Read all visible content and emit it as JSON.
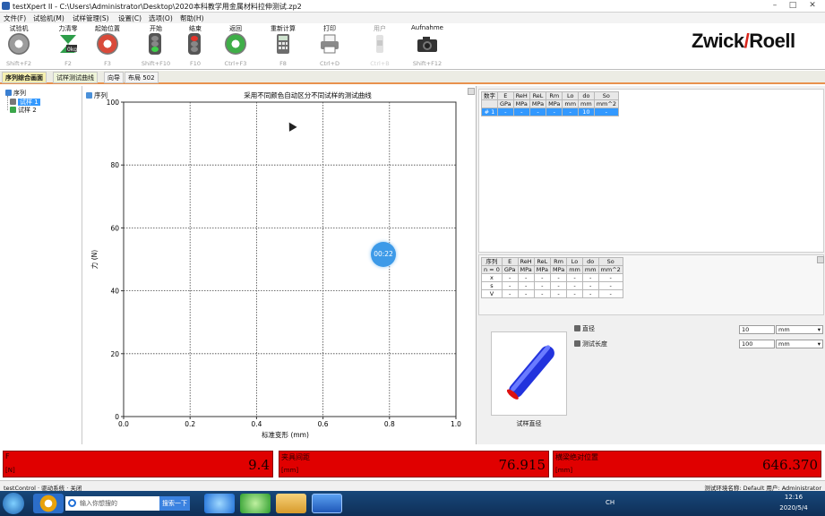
{
  "window": {
    "title": "testXpert II - C:\\Users\\Administrator\\Desktop\\2020本科教学用金属材料拉伸测试.zp2"
  },
  "menu": [
    "文件(F)",
    "试验机(M)",
    "试样管理(S)",
    "设置(C)",
    "选项(O)",
    "帮助(H)"
  ],
  "toolbar": [
    {
      "label": "试验机",
      "shortcut": "Shift+F2",
      "icon": "gear-icon"
    },
    {
      "label": "力清零",
      "shortcut": "F2",
      "icon": "force-zero-icon"
    },
    {
      "label": "起始位置",
      "shortcut": "F3",
      "icon": "gear-icon"
    },
    {
      "label": "开始",
      "shortcut": "Shift+F10",
      "icon": "traffic-light-icon"
    },
    {
      "label": "结束",
      "shortcut": "F10",
      "icon": "traffic-light-icon"
    },
    {
      "label": "返回",
      "shortcut": "Ctrl+F3",
      "icon": "gear-icon"
    },
    {
      "label": "重新计算",
      "shortcut": "F8",
      "icon": "calculator-icon"
    },
    {
      "label": "打印",
      "shortcut": "Ctrl+D",
      "icon": "printer-icon"
    },
    {
      "label": "用户",
      "shortcut": "Ctrl+B",
      "icon": "user-switch-icon"
    },
    {
      "label": "Aufnahme",
      "shortcut": "Shift+F12",
      "icon": "camera-icon"
    }
  ],
  "brand": {
    "part1": "Zwick",
    "slash": "/",
    "part2": "Roell",
    "accent": "#d9261c"
  },
  "tabs": [
    "序列综合画面",
    "试样测试曲线",
    "向导",
    "布局 502"
  ],
  "tree": {
    "root": "序列",
    "items": [
      "试样 1",
      "试样 2"
    ]
  },
  "chart_header": {
    "label": "序列"
  },
  "chart_data": {
    "type": "line",
    "title": "采用不同颜色自动区分不同试样的测试曲线",
    "xlabel": "标准变形 (mm)",
    "ylabel": "力 (N)",
    "xlim": [
      0.0,
      1.0
    ],
    "ylim": [
      0,
      100
    ],
    "xticks": [
      "0.0",
      "0.2",
      "0.4",
      "0.6",
      "0.8",
      "1.0"
    ],
    "yticks": [
      "0",
      "20",
      "40",
      "60",
      "80",
      "100"
    ],
    "grid": true,
    "series": []
  },
  "timer": "00:22",
  "results_table": {
    "headers1": [
      "数字",
      "E",
      "ReH",
      "ReL",
      "Rm",
      "Lo",
      "do",
      "So"
    ],
    "headers2": [
      "",
      "GPa",
      "MPa",
      "MPa",
      "MPa",
      "mm",
      "mm",
      "mm^2"
    ],
    "row": [
      "# 1",
      "-",
      "-",
      "-",
      "-",
      "-",
      "10",
      "-"
    ]
  },
  "stats_table": {
    "headers1": [
      "序列",
      "E",
      "ReH",
      "ReL",
      "Rm",
      "Lo",
      "do",
      "So"
    ],
    "headers2": [
      "n = 0",
      "GPa",
      "MPa",
      "MPa",
      "MPa",
      "mm",
      "mm",
      "mm^2"
    ],
    "rows": [
      [
        "x",
        "-",
        "-",
        "-",
        "-",
        "-",
        "-",
        "-"
      ],
      [
        "s",
        "-",
        "-",
        "-",
        "-",
        "-",
        "-",
        "-"
      ],
      [
        "V",
        "-",
        "-",
        "-",
        "-",
        "-",
        "-",
        "-"
      ]
    ]
  },
  "specimen": {
    "caption": "试样直径",
    "fields": [
      {
        "label": "直径",
        "value": "10",
        "unit": "mm"
      },
      {
        "label": "测试长度",
        "value": "100",
        "unit": "mm"
      }
    ]
  },
  "readouts": [
    {
      "name": "F",
      "unit": "[N]",
      "value": "9.4"
    },
    {
      "name": "夹具间距",
      "unit": "[mm]",
      "value": "76.915"
    },
    {
      "name": "横梁绝对位置",
      "unit": "[mm]",
      "value": "646.370"
    }
  ],
  "statusbar": {
    "left": "testControl · 驱动系统 · 关闭",
    "right": "测试环境名称: Default  用户: Administrator"
  },
  "taskbar": {
    "search_placeholder": "输入你想搜的",
    "search_button": "搜索一下",
    "time": "12:16",
    "date": "2020/5/4",
    "lang": "CH"
  },
  "colors": {
    "readout_bg": "#e00000",
    "tab_underline": "#e8914e",
    "selection": "#3399ff"
  }
}
